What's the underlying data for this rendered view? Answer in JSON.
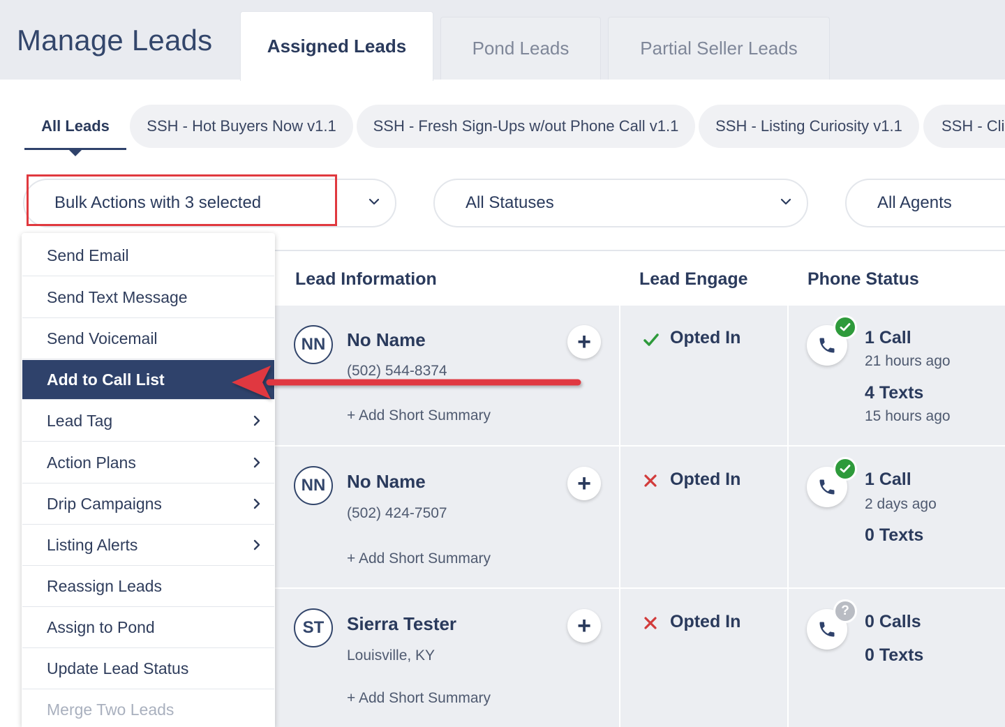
{
  "header": {
    "title": "Manage Leads",
    "tabs": [
      {
        "label": "Assigned Leads",
        "active": true
      },
      {
        "label": "Pond Leads",
        "active": false
      },
      {
        "label": "Partial Seller Leads",
        "active": false
      }
    ]
  },
  "filter_tabs": [
    {
      "label": "All Leads",
      "active": true
    },
    {
      "label": "SSH - Hot Buyers Now v1.1"
    },
    {
      "label": "SSH - Fresh Sign-Ups w/out Phone Call v1.1"
    },
    {
      "label": "SSH - Listing Curiosity v1.1"
    },
    {
      "label": "SSH - Clic"
    }
  ],
  "controls": {
    "bulk_actions": "Bulk Actions with 3 selected",
    "statuses": "All Statuses",
    "agents": "All Agents"
  },
  "bulk_menu": [
    {
      "label": "Send Email"
    },
    {
      "label": "Send Text Message"
    },
    {
      "label": "Send Voicemail"
    },
    {
      "label": "Add to Call List",
      "highlighted": true
    },
    {
      "label": "Lead Tag",
      "submenu": true
    },
    {
      "label": "Action Plans",
      "submenu": true
    },
    {
      "label": "Drip Campaigns",
      "submenu": true
    },
    {
      "label": "Listing Alerts",
      "submenu": true
    },
    {
      "label": "Reassign Leads"
    },
    {
      "label": "Assign to Pond"
    },
    {
      "label": "Update Lead Status"
    },
    {
      "label": "Merge Two Leads",
      "disabled": true
    }
  ],
  "table": {
    "headers": {
      "lead_information": "Lead Information",
      "lead_engage": "Lead Engage",
      "phone_status": "Phone Status"
    },
    "rows": [
      {
        "initials": "NN",
        "name": "No Name",
        "subtitle": "(502) 544-8374",
        "summary": "+ Add Short Summary",
        "engage_icon": "check-icon",
        "engage": "Opted In",
        "phone_badge": "check-icon",
        "calls": "1 Call",
        "calls_ago": "21 hours ago",
        "texts": "4 Texts",
        "texts_ago": "15 hours ago"
      },
      {
        "initials": "NN",
        "name": "No Name",
        "subtitle": "(502) 424-7507",
        "summary": "+ Add Short Summary",
        "engage_icon": "x-icon",
        "engage": "Opted In",
        "phone_badge": "check-icon",
        "calls": "1 Call",
        "calls_ago": "2 days ago",
        "texts": "0 Texts"
      },
      {
        "initials": "ST",
        "name": "Sierra Tester",
        "subtitle": "Louisville, KY",
        "summary": "+ Add Short Summary",
        "engage_icon": "x-icon",
        "engage": "Opted In",
        "phone_badge": "question-icon",
        "calls": "0 Calls",
        "texts": "0 Texts"
      }
    ]
  },
  "colors": {
    "primary": "#2f426b",
    "highlight_red": "#e0393f",
    "check_green": "#2e9a3b",
    "x_red": "#d23b3b",
    "unknown_gray": "#b9bcc3"
  }
}
